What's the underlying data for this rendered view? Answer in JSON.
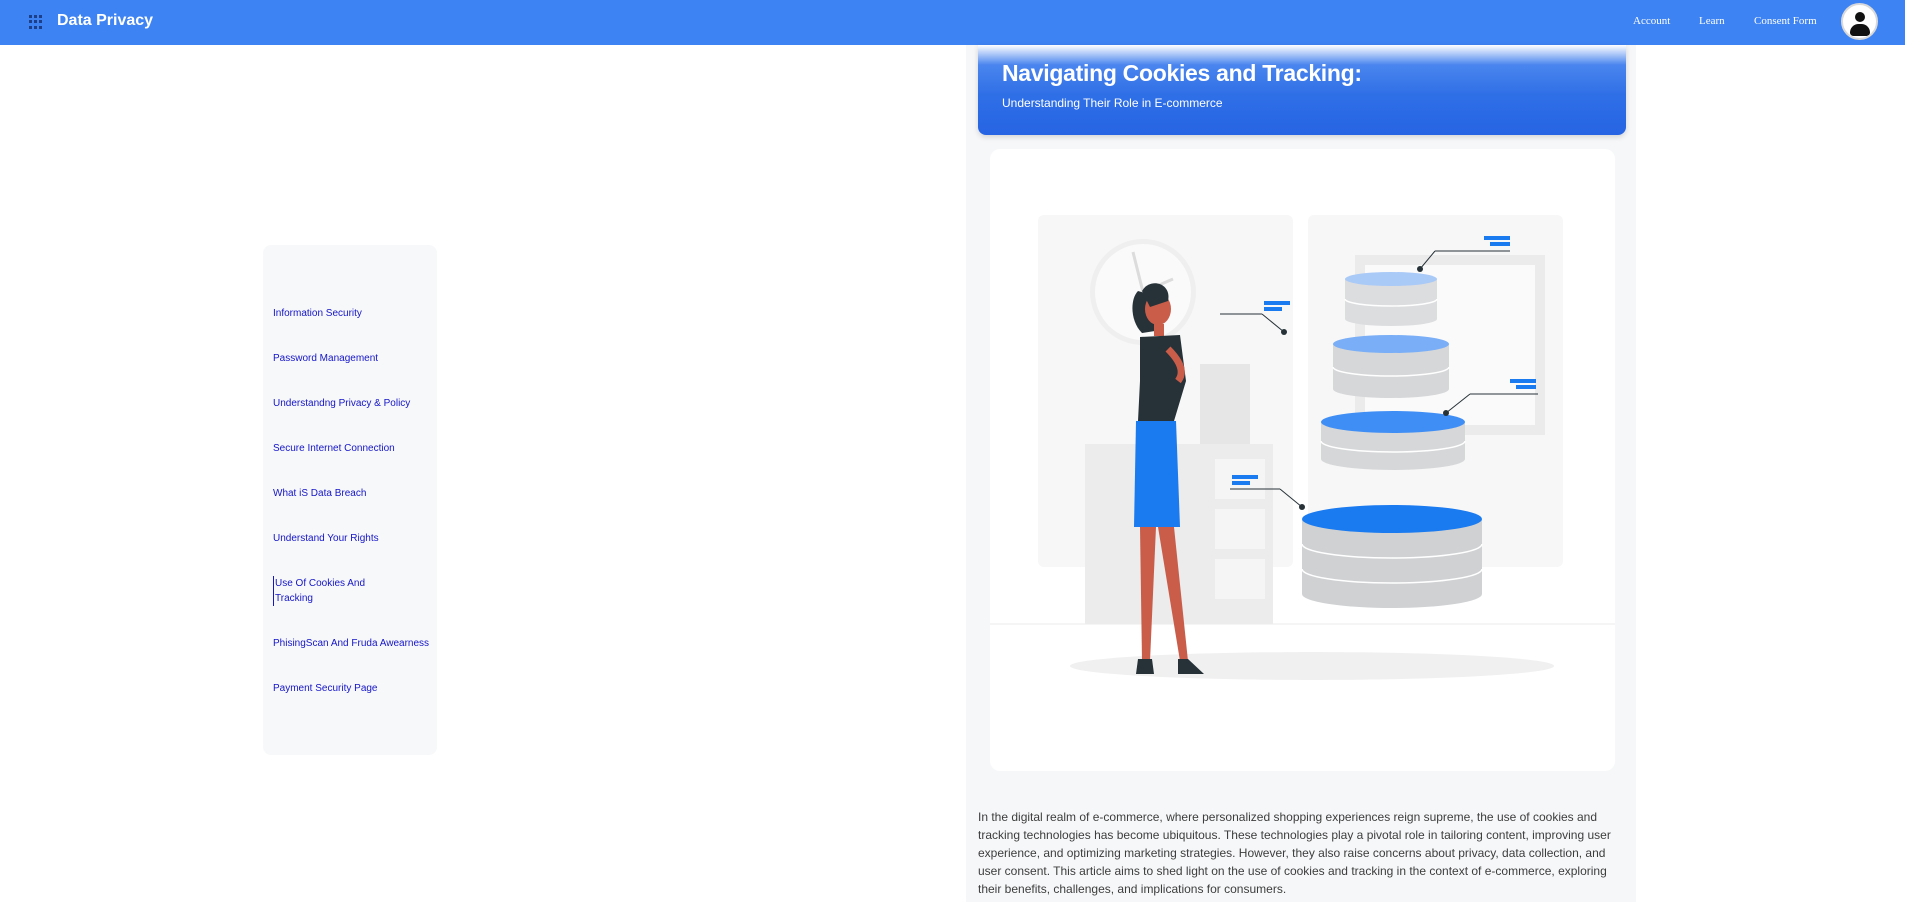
{
  "header": {
    "brand": "Data Privacy",
    "links": [
      "Account",
      "Learn",
      "Consent Form"
    ]
  },
  "sidebar": {
    "items": [
      "Information Security",
      "Password Management",
      "Understandng Privacy & Policy",
      "Secure Internet Connection",
      "What iS Data Breach",
      "Understand Your Rights",
      "Use Of Cookies And Tracking",
      "PhisingScan And Fruda Awearness",
      "Payment Security Page"
    ]
  },
  "hero": {
    "title": "Navigating Cookies and Tracking:",
    "subtitle": "Understanding Their Role in E-commerce"
  },
  "article": {
    "body": "In the digital realm of e-commerce, where personalized shopping experiences reign supreme, the use of cookies and tracking technologies has become ubiquitous. These technologies play a pivotal role in tailoring content, improving user experience, and optimizing marketing strategies. However, they also raise concerns about privacy, data collection, and user consent. This article aims to shed light on the use of cookies and tracking in the context of e-commerce, exploring their benefits, challenges, and implications for consumers."
  },
  "colors": {
    "nav": "#3e83f3",
    "link": "#1515c8",
    "accent": "#1a7af0"
  }
}
